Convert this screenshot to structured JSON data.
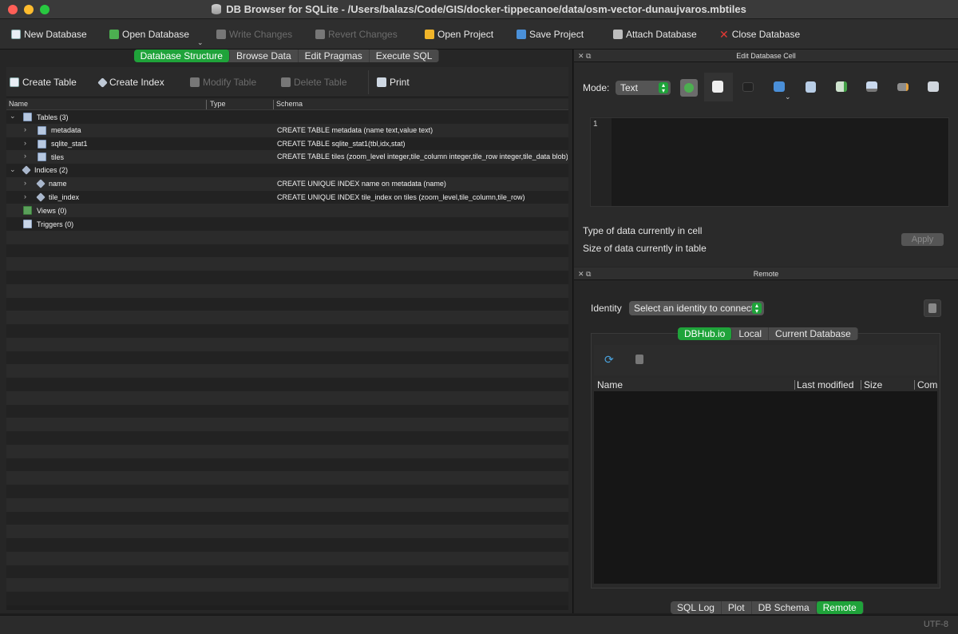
{
  "window": {
    "title": "DB Browser for SQLite - /Users/balazs/Code/GIS/docker-tippecanoe/data/osm-vector-dunaujvaros.mbtiles"
  },
  "toolbar": {
    "new_database": "New Database",
    "open_database": "Open Database",
    "write_changes": "Write Changes",
    "revert_changes": "Revert Changes",
    "open_project": "Open Project",
    "save_project": "Save Project",
    "attach_database": "Attach Database",
    "close_database": "Close Database"
  },
  "main_tabs": [
    {
      "label": "Database Structure",
      "active": true
    },
    {
      "label": "Browse Data",
      "active": false
    },
    {
      "label": "Edit Pragmas",
      "active": false
    },
    {
      "label": "Execute SQL",
      "active": false
    }
  ],
  "structure_toolbar": {
    "create_table": "Create Table",
    "create_index": "Create Index",
    "modify_table": "Modify Table",
    "delete_table": "Delete Table",
    "print": "Print"
  },
  "tree": {
    "columns": {
      "name": "Name",
      "type": "Type",
      "schema": "Schema"
    },
    "rows": [
      {
        "level": 0,
        "expand": "open",
        "icon": "table-group-icon",
        "name": "Tables (3)",
        "schema": ""
      },
      {
        "level": 1,
        "expand": "closed",
        "icon": "table-icon",
        "name": "metadata",
        "schema": "CREATE TABLE metadata (name text,value text)"
      },
      {
        "level": 1,
        "expand": "closed",
        "icon": "table-icon",
        "name": "sqlite_stat1",
        "schema": "CREATE TABLE sqlite_stat1(tbl,idx,stat)"
      },
      {
        "level": 1,
        "expand": "closed",
        "icon": "table-icon",
        "name": "tiles",
        "schema": "CREATE TABLE tiles (zoom_level integer,tile_column integer,tile_row integer,tile_data blob)"
      },
      {
        "level": 0,
        "expand": "open",
        "icon": "index-group-icon",
        "name": "Indices (2)",
        "schema": ""
      },
      {
        "level": 1,
        "expand": "closed",
        "icon": "index-icon",
        "name": "name",
        "schema": "CREATE UNIQUE INDEX name on metadata (name)"
      },
      {
        "level": 1,
        "expand": "closed",
        "icon": "index-icon",
        "name": "tile_index",
        "schema": "CREATE UNIQUE INDEX tile_index on tiles (zoom_level,tile_column,tile_row)"
      },
      {
        "level": 0,
        "expand": "none",
        "icon": "view-group-icon",
        "name": "Views (0)",
        "schema": ""
      },
      {
        "level": 0,
        "expand": "none",
        "icon": "trigger-group-icon",
        "name": "Triggers (0)",
        "schema": ""
      }
    ]
  },
  "edit_cell": {
    "title": "Edit Database Cell",
    "mode_label": "Mode:",
    "mode_value": "Text",
    "line_number": "1",
    "type_info": "Type of data currently in cell",
    "size_info": "Size of data currently in table",
    "apply": "Apply"
  },
  "remote": {
    "title": "Remote",
    "identity_label": "Identity",
    "identity_placeholder": "Select an identity to connect",
    "tabs": [
      {
        "label": "DBHub.io",
        "active": true
      },
      {
        "label": "Local",
        "active": false
      },
      {
        "label": "Current Database",
        "active": false
      }
    ],
    "columns": [
      "Name",
      "Last modified",
      "Size",
      "Com"
    ]
  },
  "bottom_tabs": [
    {
      "label": "SQL Log",
      "active": false
    },
    {
      "label": "Plot",
      "active": false
    },
    {
      "label": "DB Schema",
      "active": false
    },
    {
      "label": "Remote",
      "active": true
    }
  ],
  "status": {
    "encoding": "UTF-8"
  },
  "colors": {
    "accent": "#1fa33a",
    "close_red": "#e53935"
  }
}
